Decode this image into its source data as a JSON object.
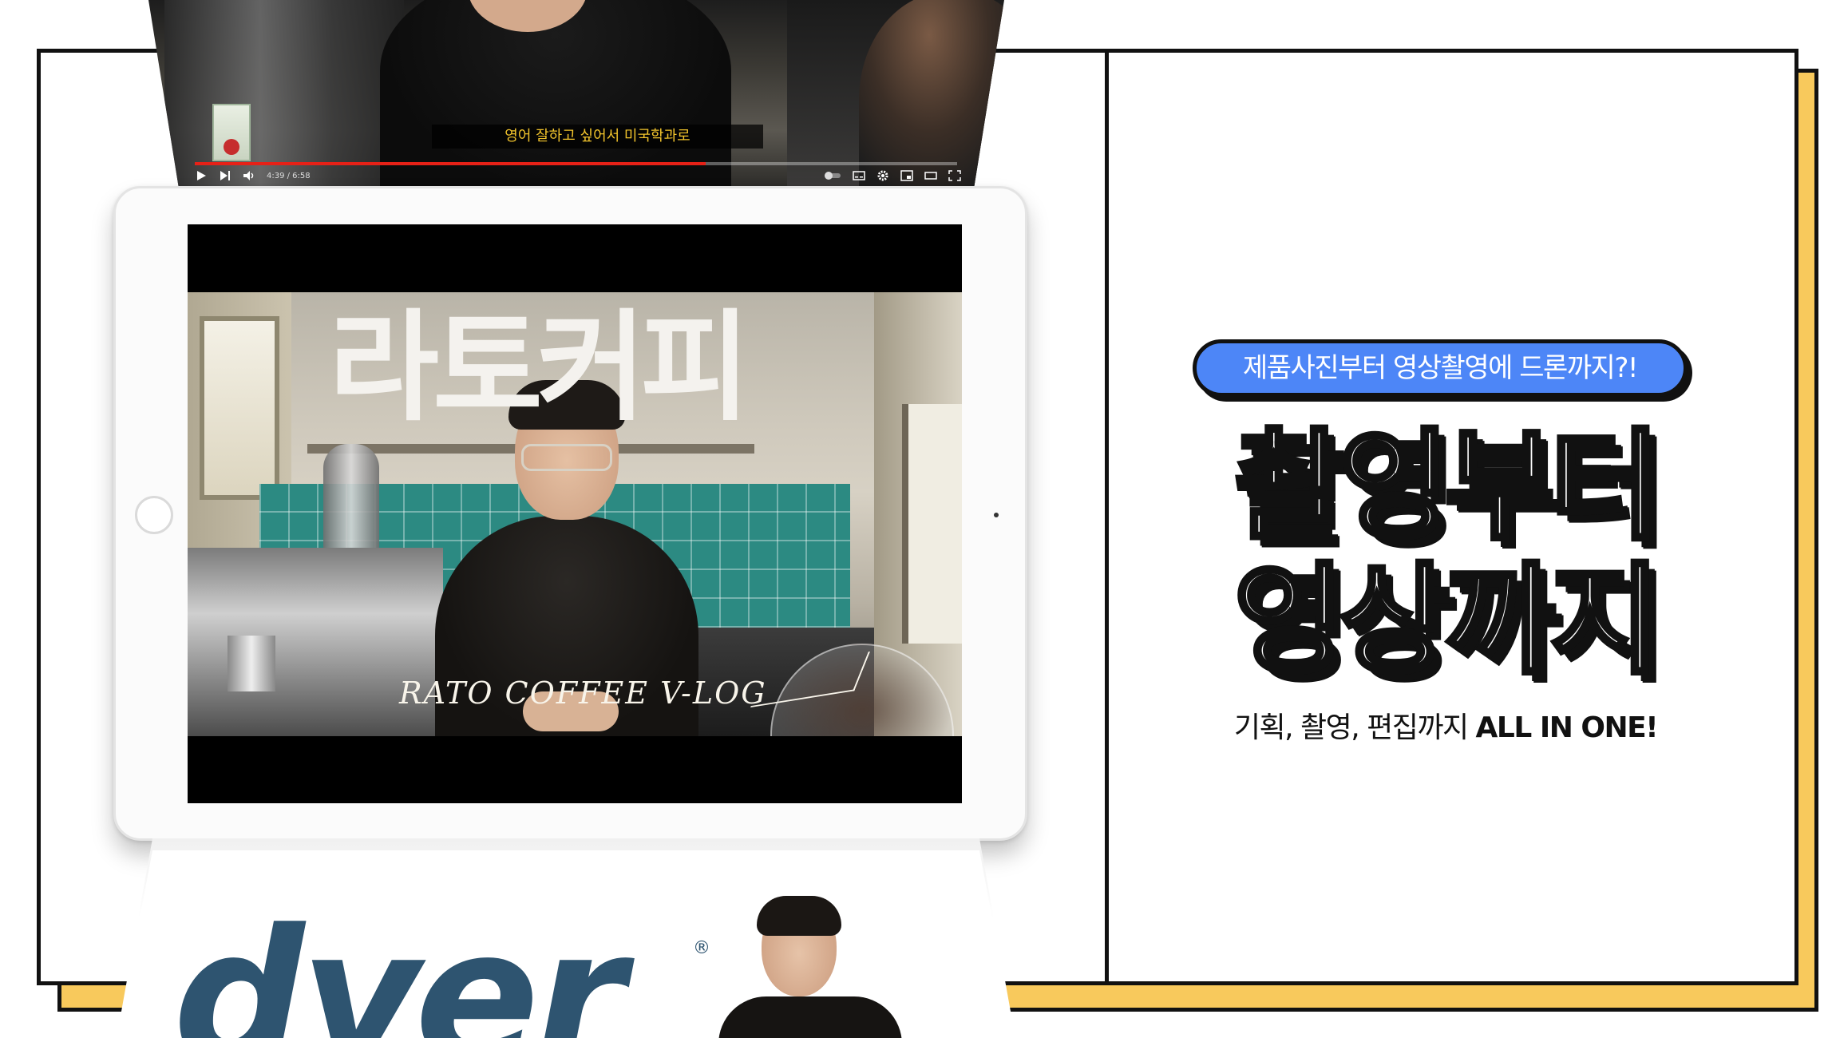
{
  "youtube_clip": {
    "subtitle": "영어 잘하고 싶어서 미국학과로",
    "time": "4:39 / 6:58",
    "progress": 0.67
  },
  "tablet_video": {
    "title": "라토커피",
    "script_caption": "RATO COFFEE V-LOG"
  },
  "promo": {
    "pill_text": "제품사진부터 영상촬영에 드론까지?!",
    "headline_line1": "촬영부터",
    "headline_line2": "영상까지",
    "subline_korean": "기획, 촬영, 편집까지",
    "subline_english": "ALL IN ONE!"
  },
  "brand": {
    "logo_text": "dyer",
    "registered_mark": "®",
    "logo_color": "#2e5470"
  },
  "colors": {
    "accent_yellow": "#f8c95c",
    "pill_blue": "#4d86f7",
    "outline": "#111111"
  }
}
